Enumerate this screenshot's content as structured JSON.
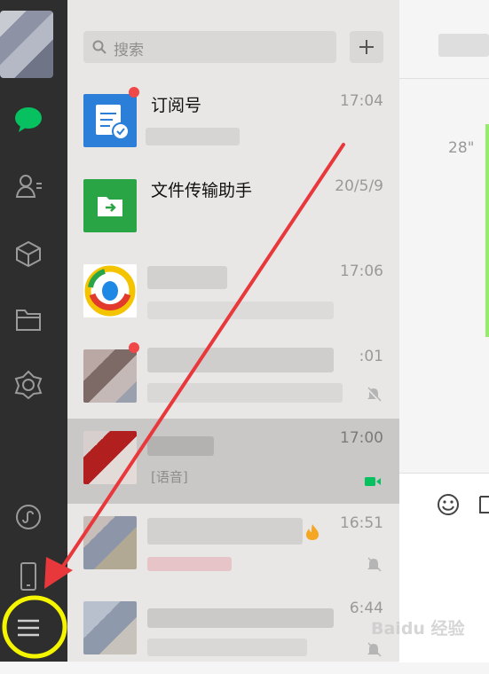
{
  "search": {
    "placeholder": "搜索"
  },
  "sidebar": {
    "icons": [
      "chat-icon",
      "contacts-icon",
      "favorites-icon",
      "files-icon",
      "moments-icon",
      "miniprogram-icon",
      "phone-icon",
      "menu-icon"
    ]
  },
  "chats": [
    {
      "title": "订阅号",
      "time": "17:04",
      "sub": ""
    },
    {
      "title": "文件传输助手",
      "time": "20/5/9",
      "sub": ""
    },
    {
      "title": "",
      "time": "17:06",
      "sub": ""
    },
    {
      "title": "",
      "time": ":01",
      "sub": ""
    },
    {
      "title": "",
      "time": "17:00",
      "sub": "[语音]"
    },
    {
      "title": "",
      "time": "16:51",
      "sub": ""
    },
    {
      "title": "",
      "time": "6:44",
      "sub": ""
    }
  ],
  "chat_panel": {
    "duration": "28\""
  },
  "watermark": "Baidu 经验",
  "colors": {
    "wechat_green": "#07c160",
    "annotation_red": "#e8383c",
    "highlight_yellow": "#f5f500"
  }
}
